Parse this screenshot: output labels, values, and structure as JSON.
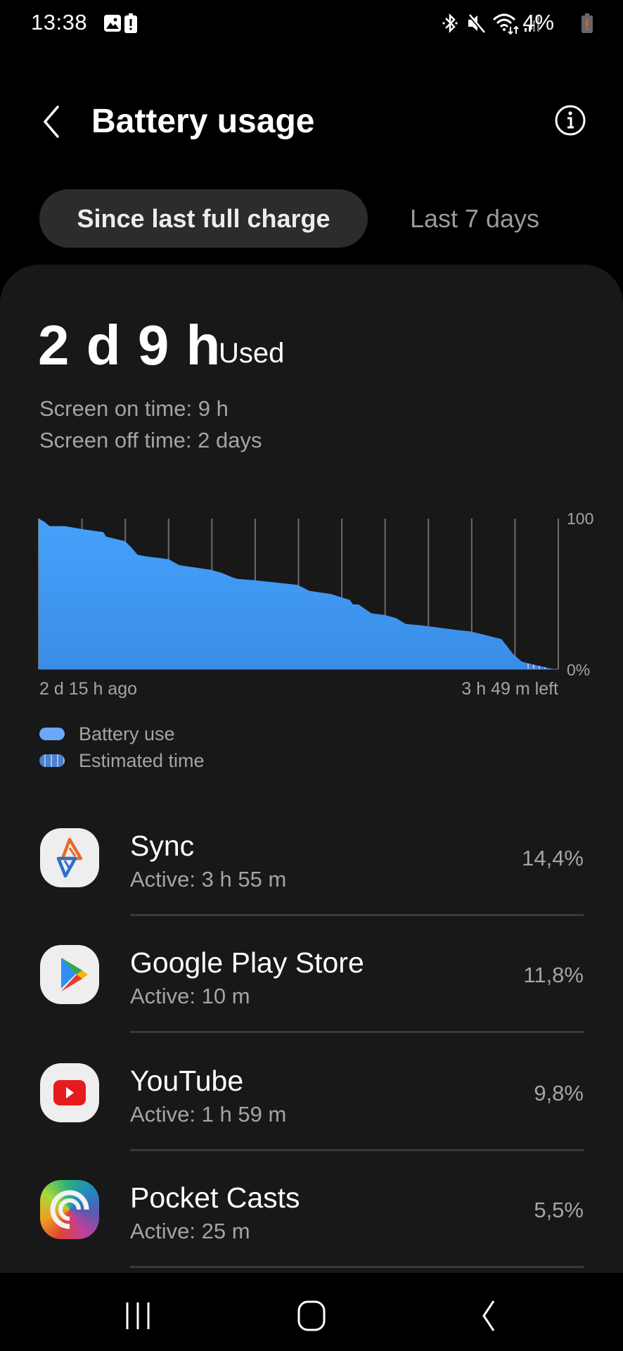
{
  "status_bar": {
    "time": "13:38",
    "left_icons": [
      "gallery-notification-icon",
      "battery-alert-notification-icon"
    ],
    "right_icons": [
      "bluetooth-icon",
      "mute-icon",
      "wifi-icon",
      "signal-icon"
    ],
    "battery_percent": "4%",
    "battery_alert_color": "#e8582f"
  },
  "header": {
    "back_icon": "chevron-left-icon",
    "title": "Battery usage",
    "info_icon": "info-icon"
  },
  "tabs": [
    {
      "label": "Since last full charge",
      "selected": true
    },
    {
      "label": "Last 7 days",
      "selected": false
    }
  ],
  "summary": {
    "used_value": "2 d 9 h",
    "used_label": "Used",
    "screen_on": "Screen on time: 9 h",
    "screen_off": "Screen off time: 2 days"
  },
  "colors": {
    "battery_use": "#4a9ef5",
    "battery_use_bottom": "#3b8de6",
    "estimated": "#7aa6df",
    "card_bg": "#181818",
    "gridline": "#6a6a6a"
  },
  "chart_data": {
    "type": "area",
    "title": "",
    "xlabel": "",
    "ylabel": "",
    "x_unit": "hours since last full charge",
    "x_start_label": "2 d 15 h ago",
    "x_end_label": "3 h 49 m left",
    "xlim": [
      0,
      66.8
    ],
    "ylim": [
      0,
      100
    ],
    "y_tick_labels": [
      "100",
      "0%"
    ],
    "grid": "vertical",
    "gridline_count": 12,
    "series": [
      {
        "name": "Battery use",
        "points": [
          [
            0,
            100
          ],
          [
            0.7,
            98
          ],
          [
            1.4,
            95
          ],
          [
            3.4,
            95
          ],
          [
            5.6,
            93
          ],
          [
            8.3,
            91
          ],
          [
            8.7,
            88
          ],
          [
            11.1,
            85
          ],
          [
            11.9,
            81
          ],
          [
            12.7,
            76
          ],
          [
            13.7,
            75
          ],
          [
            16.7,
            73
          ],
          [
            17.4,
            71
          ],
          [
            18.1,
            69
          ],
          [
            22.1,
            66
          ],
          [
            23.5,
            64
          ],
          [
            24.9,
            61
          ],
          [
            25.5,
            60
          ],
          [
            27.8,
            59
          ],
          [
            33.3,
            56
          ],
          [
            34.8,
            52
          ],
          [
            37.5,
            50
          ],
          [
            40.0,
            46
          ],
          [
            40.4,
            43
          ],
          [
            41.1,
            43
          ],
          [
            42.8,
            37
          ],
          [
            44.5,
            36
          ],
          [
            45.9,
            34
          ],
          [
            47.2,
            30
          ],
          [
            49.3,
            29
          ],
          [
            53.8,
            26
          ],
          [
            55.6,
            25
          ],
          [
            59.5,
            20
          ],
          [
            61.0,
            10
          ],
          [
            62.1,
            5
          ],
          [
            62.8,
            4
          ]
        ]
      },
      {
        "name": "Estimated time",
        "points": [
          [
            62.8,
            4
          ],
          [
            66.2,
            0
          ]
        ]
      }
    ],
    "legend": [
      "Battery use",
      "Estimated time"
    ],
    "legend_position": "bottom-left"
  },
  "apps": [
    {
      "name": "Sync",
      "active": "Active: 3 h 55 m",
      "percent": "14,4%",
      "icon": "sync-app-icon"
    },
    {
      "name": "Google Play Store",
      "active": "Active: 10 m",
      "percent": "11,8%",
      "icon": "google-play-store-icon"
    },
    {
      "name": "YouTube",
      "active": "Active: 1 h 59 m",
      "percent": "9,8%",
      "icon": "youtube-icon"
    },
    {
      "name": "Pocket Casts",
      "active": "Active: 25 m",
      "percent": "5,5%",
      "icon": "pocket-casts-icon"
    }
  ],
  "nav": {
    "recents": "recents-icon",
    "home": "home-icon",
    "back": "back-icon"
  }
}
